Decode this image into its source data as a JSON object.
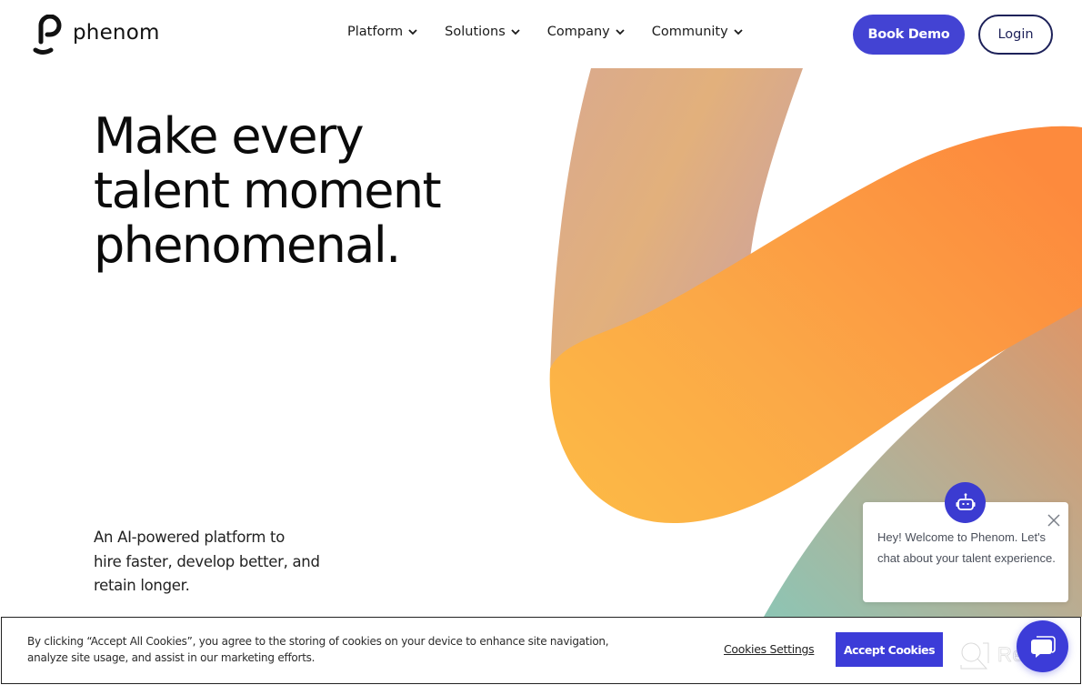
{
  "header": {
    "brand": "phenom",
    "nav": [
      {
        "label": "Platform"
      },
      {
        "label": "Solutions"
      },
      {
        "label": "Company"
      },
      {
        "label": "Community"
      }
    ],
    "book_demo_label": "Book Demo",
    "login_label": "Login"
  },
  "hero": {
    "title_lines": [
      "Make every",
      "talent moment",
      "phenomenal."
    ],
    "subtitle_lines": [
      "An AI-powered platform to",
      "hire faster, develop better, and",
      "retain longer."
    ]
  },
  "chat": {
    "message": "Hey! Welcome to Phenom. Let's chat about your talent experience.",
    "close_icon": "close-icon",
    "avatar_icon": "robot-icon"
  },
  "cookie_banner": {
    "text_lines": [
      "By clicking “Accept All Cookies”, you agree to the storing of cookies on your device to enhance site navigation,",
      "analyze site usage, and assist in our marketing efforts."
    ],
    "settings_label": "Cookies Settings",
    "accept_label": "Accept Cookies"
  },
  "watermark": {
    "text": "Revain"
  },
  "colors": {
    "brand_primary": "#4343d3",
    "login_border": "#1d2159",
    "accept_button": "#3c3cd8",
    "art_orange": "#fd8c3f",
    "art_yellow": "#fdb940",
    "art_teal": "#8fc3b3"
  }
}
